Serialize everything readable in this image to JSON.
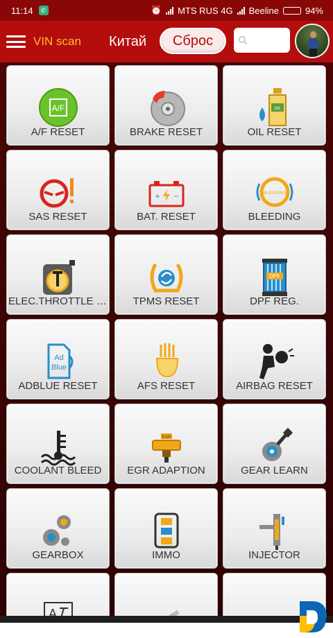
{
  "status_bar": {
    "time": "11:14",
    "carrier1": "MTS RUS 4G",
    "carrier2": "Beeline",
    "battery": "94%",
    "battery_level": 0.94
  },
  "header": {
    "menu_icon": "hamburger-icon",
    "vin_scan": "VIN scan",
    "country": "Китай",
    "reset_button": "Сброс",
    "search_placeholder": "",
    "search_icon": "search-icon",
    "avatar": "user-avatar"
  },
  "colors": {
    "header_bg": "#b30d0d",
    "status_bg": "#8a0707",
    "vin_text": "#ffbd2e",
    "grid_bg": "#3a0303",
    "tile_label": "#333333"
  },
  "tiles": [
    {
      "label": "A/F RESET",
      "icon": "af-reset-icon"
    },
    {
      "label": "BRAKE RESET",
      "icon": "brake-disc-icon"
    },
    {
      "label": "OIL RESET",
      "icon": "oil-bottle-icon"
    },
    {
      "label": "SAS RESET",
      "icon": "steering-wheel-icon"
    },
    {
      "label": "BAT. RESET",
      "icon": "battery-icon"
    },
    {
      "label": "BLEEDING",
      "icon": "bleeding-icon"
    },
    {
      "label": "ELEC.THROTTLE R...",
      "icon": "throttle-icon"
    },
    {
      "label": "TPMS RESET",
      "icon": "tire-pressure-icon"
    },
    {
      "label": "DPF REG.",
      "icon": "dpf-filter-icon"
    },
    {
      "label": "ADBLUE RESET",
      "icon": "adblue-icon"
    },
    {
      "label": "AFS RESET",
      "icon": "headlight-icon"
    },
    {
      "label": "AIRBAG RESET",
      "icon": "airbag-icon"
    },
    {
      "label": "COOLANT BLEED",
      "icon": "coolant-icon"
    },
    {
      "label": "EGR ADAPTION",
      "icon": "egr-valve-icon"
    },
    {
      "label": "GEAR LEARN",
      "icon": "gear-learn-icon"
    },
    {
      "label": "GEARBOX",
      "icon": "gearbox-icon"
    },
    {
      "label": "IMMO",
      "icon": "immobilizer-icon"
    },
    {
      "label": "INJECTOR",
      "icon": "injector-icon"
    },
    {
      "label": "",
      "icon": "text-font-icon"
    },
    {
      "label": "",
      "icon": "spark-plug-icon"
    },
    {
      "label": "",
      "icon": "gauge-icon"
    }
  ],
  "icons": {
    "af_text": "A/F",
    "oil_tag": "OIL",
    "bleeding_text": "BLEEDING",
    "adblue_line1": "Ad",
    "adblue_line2": "Blue",
    "dpf_text": "DPF",
    "egr_text": "EGR",
    "font_text": "A"
  }
}
